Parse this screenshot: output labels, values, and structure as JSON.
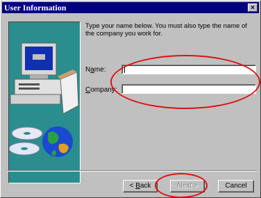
{
  "window": {
    "title": "User Information",
    "close_glyph": "×"
  },
  "instructions": "Type your name below. You must also type the name of the company you work for.",
  "form": {
    "name_label_pre": "N",
    "name_label_ul": "a",
    "name_label_post": "me:",
    "company_label_pre": "",
    "company_label_ul": "C",
    "company_label_post": "ompany:",
    "name_value": "",
    "company_value": ""
  },
  "buttons": {
    "back_pre": "< ",
    "back_ul": "B",
    "back_post": "ack",
    "next": "Next >",
    "cancel": "Cancel"
  },
  "illustration": {
    "icons": [
      "computer-icon",
      "cd-disc-icon",
      "globe-icon",
      "box-icon"
    ]
  },
  "annotations": {
    "color": "#e01010"
  }
}
